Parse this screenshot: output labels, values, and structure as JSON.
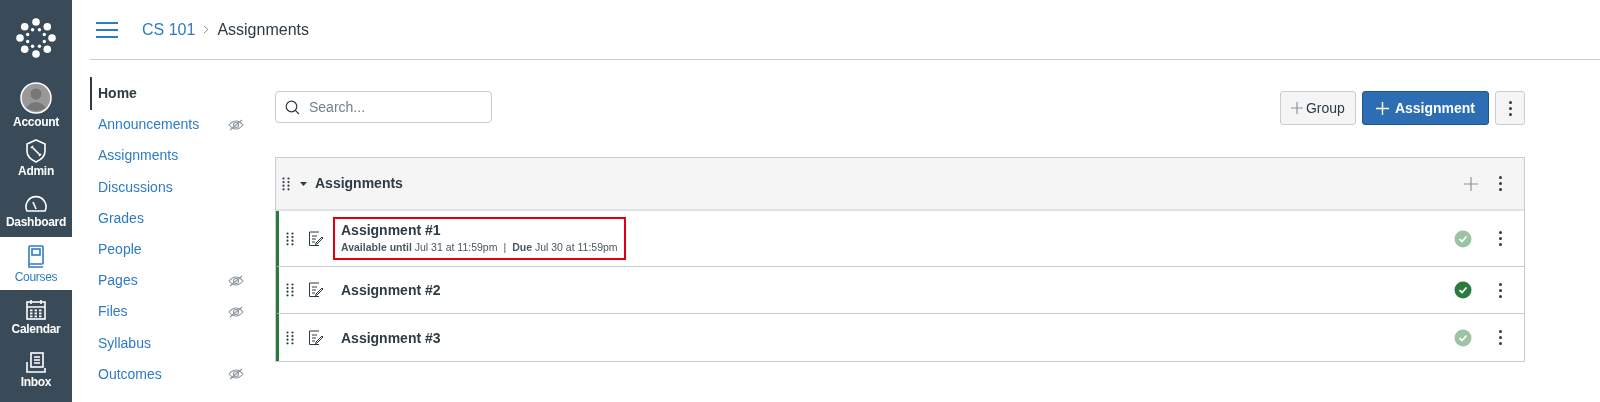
{
  "global_nav": [
    {
      "label": "Account",
      "selected": false
    },
    {
      "label": "Admin",
      "selected": false
    },
    {
      "label": "Dashboard",
      "selected": false
    },
    {
      "label": "Courses",
      "selected": true
    },
    {
      "label": "Calendar",
      "selected": false
    },
    {
      "label": "Inbox",
      "selected": false
    }
  ],
  "breadcrumb": [
    "CS 101",
    "Assignments"
  ],
  "course_nav": [
    {
      "label": "Home",
      "selected": true,
      "hidden": false
    },
    {
      "label": "Announcements",
      "selected": false,
      "hidden": true
    },
    {
      "label": "Assignments",
      "selected": false,
      "hidden": false
    },
    {
      "label": "Discussions",
      "selected": false,
      "hidden": false
    },
    {
      "label": "Grades",
      "selected": false,
      "hidden": false
    },
    {
      "label": "People",
      "selected": false,
      "hidden": false
    },
    {
      "label": "Pages",
      "selected": false,
      "hidden": true
    },
    {
      "label": "Files",
      "selected": false,
      "hidden": true
    },
    {
      "label": "Syllabus",
      "selected": false,
      "hidden": false
    },
    {
      "label": "Outcomes",
      "selected": false,
      "hidden": true
    }
  ],
  "search": {
    "placeholder": "Search..."
  },
  "buttons": {
    "group": "Group",
    "assignment": "Assignment"
  },
  "group": {
    "title": "Assignments",
    "expanded": true,
    "rows": [
      {
        "title": "Assignment #1",
        "details": [
          "**Available until** Jul 31 at 11:59pm",
          "**Due** Jul 30 at 11:59pm"
        ],
        "separator": "|",
        "published": false,
        "highlighted": true
      },
      {
        "title": "Assignment #2",
        "details": [],
        "published": true,
        "highlighted": false
      },
      {
        "title": "Assignment #3",
        "details": [],
        "published": false,
        "highlighted": false
      }
    ]
  }
}
